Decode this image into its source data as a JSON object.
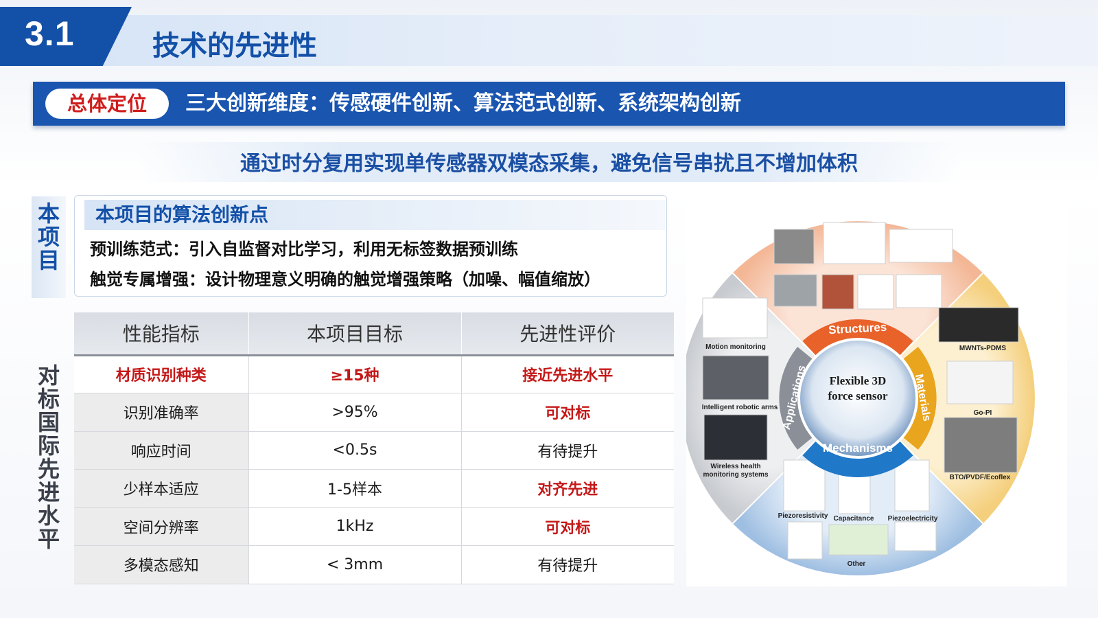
{
  "header": {
    "section_number": "3.1",
    "title": "技术的先进性"
  },
  "positioning": {
    "pill": "总体定位",
    "text": "三大创新维度：传感硬件创新、算法范式创新、系统架构创新"
  },
  "subtitle": "通过时分复用实现单传感器双模态采集，避免信号串扰且不增加体积",
  "side_labels": {
    "top": [
      "本",
      "项",
      "目"
    ],
    "bottom": [
      "对",
      "标",
      "国",
      "际",
      "先",
      "进",
      "水",
      "平"
    ]
  },
  "algorithm": {
    "title": "本项目的算法创新点",
    "line1": "预训练范式：引入自监督对比学习，利用无标签数据预训练",
    "line2": "触觉专属增强：设计物理意义明确的触觉增强策略（加噪、幅值缩放）"
  },
  "table": {
    "headers": [
      "性能指标",
      "本项目目标",
      "先进性评价"
    ],
    "rows": [
      [
        "材质识别种类",
        "≥15种",
        "接近先进水平"
      ],
      [
        "识别准确率",
        ">95%",
        "可对标"
      ],
      [
        "响应时间",
        "<0.5s",
        "有待提升"
      ],
      [
        "少样本适应",
        "1-5样本",
        "对齐先进"
      ],
      [
        "空间分辨率",
        "1kHz",
        "可对标"
      ],
      [
        "多模态感知",
        "< 3mm",
        "有待提升"
      ]
    ]
  },
  "figure": {
    "center_line1": "Flexible 3D",
    "center_line2": "force sensor",
    "ring": {
      "structures": "Structures",
      "materials": "Materials",
      "mechanisms": "Mechanisms",
      "applications": "Applications"
    },
    "labels": {
      "motion": "Motion monitoring",
      "robotic": "Intelligent robotic arms",
      "wireless1": "Wireless health",
      "wireless2": "monitoring systems",
      "mwnt": "MWNTs-PDMS",
      "gopi": "Go-PI",
      "bto": "BTO/PVDF/Ecoflex",
      "piezores": "Piezoresistivity",
      "capacitance": "Capacitance",
      "piezoelec": "Piezoelectricity",
      "other": "Other"
    },
    "colors": {
      "structures": "#e8622a",
      "materials": "#eaa51e",
      "mechanisms": "#1f78c8",
      "applications": "#8a8f98"
    }
  }
}
